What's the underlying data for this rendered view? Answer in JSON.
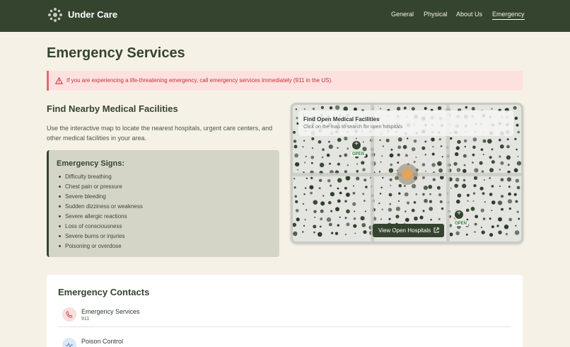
{
  "header": {
    "brand": "Under Care",
    "nav": [
      "General",
      "Physical",
      "About Us",
      "Emergency"
    ],
    "active_nav": "Emergency"
  },
  "page": {
    "title": "Emergency Services",
    "alert": "If you are experiencing a life-threatening emergency, call emergency services immediately (911 in the US)."
  },
  "facilities": {
    "heading": "Find Nearby Medical Facilities",
    "description": "Use the interactive map to locate the nearest hospitals, urgent care centers, and other medical facilities in your area."
  },
  "signs": {
    "heading": "Emergency Signs:",
    "items": [
      "Difficulty breathing",
      "Chest pain or pressure",
      "Severe bleeding",
      "Sudden dizziness or weakness",
      "Severe allergic reactions",
      "Loss of consciousness",
      "Severe burns or injuries",
      "Poisoning or overdose"
    ]
  },
  "map": {
    "title": "Find Open Medical Facilities",
    "subtitle": "Click on the map to search for open hospitals",
    "open_label": "OPEN",
    "button": "View Open Hospitals"
  },
  "contacts": {
    "heading": "Emergency Contacts",
    "items": [
      {
        "name": "Emergency Services",
        "number": "911",
        "icon": "phone-icon",
        "color": "#e57373"
      },
      {
        "name": "Poison Control",
        "number": "",
        "icon": "pulse-icon",
        "color": "#5b8fd6"
      }
    ]
  },
  "colors": {
    "header_bg": "#34442f",
    "page_bg": "#f6f1e6",
    "alert_bg": "#fde1e1",
    "alert_text": "#c53030",
    "accent": "#34442f"
  }
}
